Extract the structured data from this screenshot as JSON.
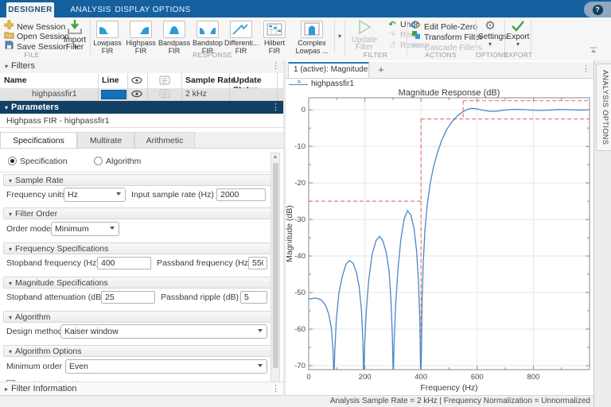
{
  "topbar": {
    "tabs": [
      "DESIGNER",
      "ANALYSIS",
      "DISPLAY OPTIONS"
    ],
    "active_tab": "DESIGNER",
    "help_icon": "?"
  },
  "icons": {
    "menu_dots": "⋮",
    "close": "×",
    "add_tab": "+",
    "dropdown": "▾",
    "collapse_down": "▾",
    "collapse_right": "▸",
    "gear": "⚙",
    "undo": "↶",
    "redo": "↷",
    "restore": "↺",
    "up": "▲",
    "down": "▼",
    "eye": "👁"
  },
  "ribbon": {
    "file": {
      "section": "FILE",
      "new_session": "New Session",
      "open_session": "Open Session",
      "save_session": "Save Session",
      "import_l1": "Import",
      "import_l2": "Filter"
    },
    "response": {
      "section": "RESPONSE",
      "items": [
        {
          "l1": "Lowpass",
          "l2": "FIR"
        },
        {
          "l1": "Highpass",
          "l2": "FIR"
        },
        {
          "l1": "Bandpass",
          "l2": "FIR"
        },
        {
          "l1": "Bandstop",
          "l2": "FIR"
        },
        {
          "l1": "Differenti...",
          "l2": "FIR"
        },
        {
          "l1": "Hilbert FIR",
          "l2": ""
        },
        {
          "l1": "Complex",
          "l2": "Lowpas ..."
        }
      ]
    },
    "filter": {
      "section": "FILTER",
      "update_l1": "Update",
      "update_l2": "Filter",
      "undo": "Undo",
      "redo": "Redo",
      "restore": "Restore"
    },
    "actions": {
      "section": "ACTIONS",
      "edit_pole_zero": "Edit Pole-Zero",
      "transform_filter": "Transform Filter",
      "cascade_filters": "Cascade Filters"
    },
    "options": {
      "section": "OPTIONS",
      "settings": "Settings"
    },
    "export": {
      "section": "EXPORT",
      "export": "Export"
    }
  },
  "filters_panel": {
    "title": "Filters",
    "col_name": "Name",
    "col_line": "Line",
    "col_sample_rate": "Sample Rate",
    "col_update_status": "Update Status",
    "row": {
      "name": "highpassfir1",
      "line_color": "#1372b8",
      "sample_rate": "2 kHz",
      "update_status": ""
    }
  },
  "parameters": {
    "title": "Parameters",
    "subtitle": "Highpass FIR - highpassfir1",
    "tabs": [
      "Specifications",
      "Multirate",
      "Arithmetic"
    ],
    "active_tab": "Specifications",
    "radio_specification": "Specification",
    "radio_algorithm": "Algorithm",
    "radio_selected": "Specification",
    "sample_rate": {
      "title": "Sample Rate",
      "freq_units_label": "Frequency units",
      "freq_units_value": "Hz",
      "input_rate_label": "Input sample rate (Hz)",
      "input_rate_value": "2000"
    },
    "filter_order": {
      "title": "Filter Order",
      "order_mode_label": "Order mode",
      "order_mode_value": "Minimum"
    },
    "frequency_specifications": {
      "title": "Frequency Specifications",
      "stopband_label": "Stopband frequency (Hz)",
      "stopband_value": "400",
      "passband_label": "Passband frequency (Hz)",
      "passband_value": "550"
    },
    "magnitude_specifications": {
      "title": "Magnitude Specifications",
      "attenuation_label": "Stopband attenuation (dB)",
      "attenuation_value": "25",
      "ripple_label": "Passband ripple (dB)",
      "ripple_value": "5"
    },
    "algorithm": {
      "title": "Algorithm",
      "design_method_label": "Design method",
      "design_method_value": "Kaiser window"
    },
    "algorithm_options": {
      "title": "Algorithm Options",
      "minimum_order_label": "Minimum order",
      "minimum_order_value": "Even",
      "scale_passband_label": "Scale passband",
      "scale_passband_checked": false
    },
    "filter_information": "Filter Information"
  },
  "plot": {
    "tab_label": "1 (active): Magnitude",
    "legend_label": "highpassfir1"
  },
  "chart_data": {
    "type": "line",
    "title": "Magnitude Response (dB)",
    "xlabel": "Frequency (Hz)",
    "ylabel": "Magnitude (dB)",
    "xlim": [
      0,
      1000
    ],
    "ylim": [
      -71.1,
      3.3
    ],
    "xticks": [
      0,
      200,
      400,
      600,
      800
    ],
    "yticks": [
      0,
      -10,
      -20,
      -30,
      -40,
      -50,
      -60,
      -70
    ],
    "xminor": [
      100,
      300,
      500,
      700,
      900
    ],
    "yminor": [
      -5,
      -15,
      -25,
      -35,
      -45,
      -55,
      -65
    ],
    "grid": true,
    "line_color": "#4a87c7",
    "mask_color": "#e87b72",
    "legend": [
      {
        "label": "highpassfir1",
        "color": "#4a87c7"
      }
    ],
    "series": [
      {
        "name": "highpassfir1",
        "points": [
          [
            0,
            -51.8
          ],
          [
            25,
            -51.5
          ],
          [
            45,
            -52
          ],
          [
            60,
            -53.5
          ],
          [
            72,
            -56
          ],
          [
            81,
            -60
          ],
          [
            87,
            -66
          ],
          [
            90,
            -74
          ],
          [
            93,
            -66
          ],
          [
            99,
            -57
          ],
          [
            108,
            -50
          ],
          [
            120,
            -45.5
          ],
          [
            133,
            -42.3
          ],
          [
            145,
            -41.2
          ],
          [
            158,
            -42
          ],
          [
            170,
            -44.5
          ],
          [
            180,
            -48.5
          ],
          [
            188,
            -55
          ],
          [
            193,
            -63
          ],
          [
            196,
            -74
          ],
          [
            199,
            -65
          ],
          [
            205,
            -55
          ],
          [
            214,
            -46.5
          ],
          [
            226,
            -39.5
          ],
          [
            240,
            -35.8
          ],
          [
            252,
            -34.6
          ],
          [
            264,
            -35.8
          ],
          [
            276,
            -39
          ],
          [
            286,
            -44
          ],
          [
            293,
            -52
          ],
          [
            298,
            -62
          ],
          [
            301,
            -74
          ],
          [
            304,
            -64
          ],
          [
            310,
            -53
          ],
          [
            318,
            -43.5
          ],
          [
            328,
            -35.5
          ],
          [
            340,
            -29.8
          ],
          [
            352,
            -27.6
          ],
          [
            364,
            -28.8
          ],
          [
            375,
            -32.5
          ],
          [
            384,
            -38.5
          ],
          [
            391,
            -47
          ],
          [
            396,
            -58
          ],
          [
            399,
            -74
          ],
          [
            401,
            -68
          ],
          [
            404,
            -52
          ],
          [
            408,
            -42
          ],
          [
            414,
            -33
          ],
          [
            422,
            -26
          ],
          [
            432,
            -20.5
          ],
          [
            444,
            -15.8
          ],
          [
            458,
            -11.8
          ],
          [
            474,
            -8.3
          ],
          [
            492,
            -5.3
          ],
          [
            512,
            -3.1
          ],
          [
            532,
            -1.5
          ],
          [
            552,
            -0.35
          ],
          [
            570,
            0.25
          ],
          [
            585,
            0.4
          ],
          [
            600,
            0.25
          ],
          [
            620,
            -0.1
          ],
          [
            645,
            -0.4
          ],
          [
            668,
            -0.35
          ],
          [
            690,
            -0.15
          ],
          [
            715,
            0.05
          ],
          [
            740,
            0.15
          ],
          [
            770,
            0.05
          ],
          [
            800,
            -0.1
          ],
          [
            830,
            -0.15
          ],
          [
            860,
            -0.05
          ],
          [
            890,
            0.08
          ],
          [
            920,
            0.05
          ],
          [
            950,
            -0.05
          ],
          [
            975,
            -0.02
          ],
          [
            1000,
            0.02
          ]
        ]
      }
    ],
    "mask_segments": [
      [
        [
          0,
          -25
        ],
        [
          400,
          -25
        ]
      ],
      [
        [
          400,
          -2.5
        ],
        [
          400,
          -74
        ]
      ],
      [
        [
          400,
          -2.5
        ],
        [
          1000,
          -2.5
        ]
      ],
      [
        [
          550,
          2.5
        ],
        [
          550,
          -2.5
        ]
      ],
      [
        [
          550,
          2.5
        ],
        [
          1000,
          2.5
        ]
      ],
      [
        [
          1000,
          2.5
        ],
        [
          1000,
          -2.5
        ]
      ]
    ]
  },
  "status_bar": "Analysis Sample Rate = 2 kHz | Frequency Normalization = Unnormalized",
  "analysis_options_label": "ANALYSIS OPTIONS"
}
